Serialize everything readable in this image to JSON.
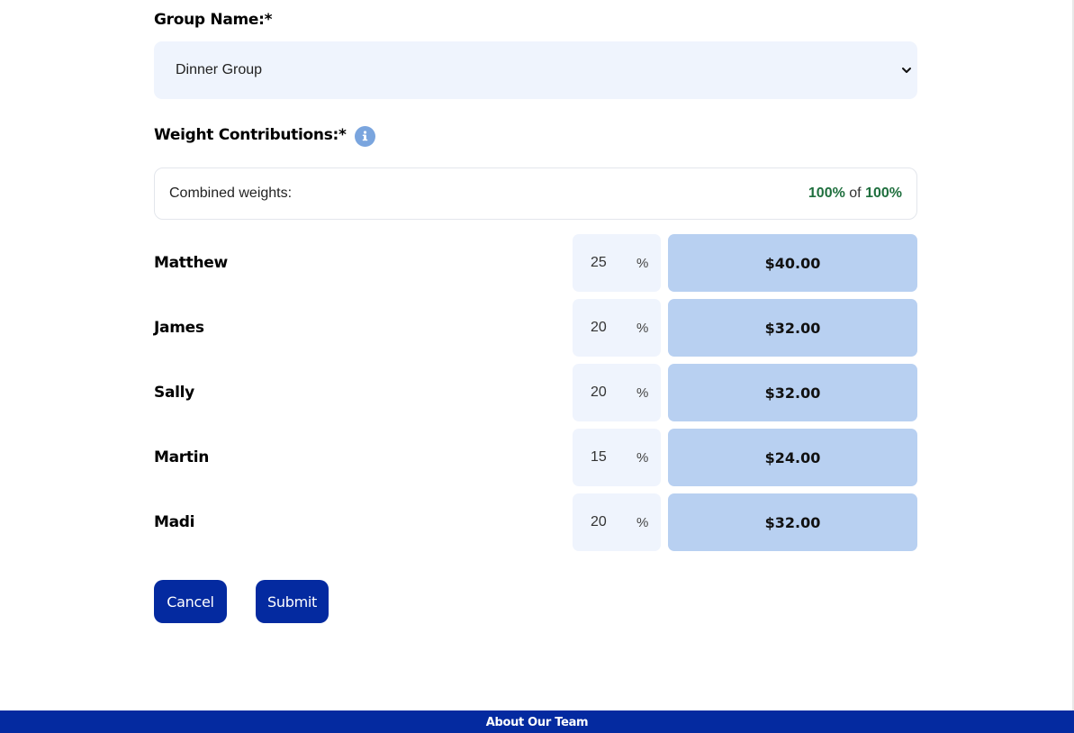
{
  "form": {
    "group_label": "Group Name:*",
    "group_select": {
      "selected": "Dinner Group",
      "icon": "chevron-down-icon"
    },
    "weights_label": "Weight Contributions:*",
    "info_icon": "info-icon",
    "combined": {
      "label": "Combined weights:",
      "current": "100%",
      "of_text": "of",
      "total": "100%"
    },
    "members": [
      {
        "name": "Matthew",
        "weight": "25",
        "unit": "%",
        "amount": "$40.00"
      },
      {
        "name": "James",
        "weight": "20",
        "unit": "%",
        "amount": "$32.00"
      },
      {
        "name": "Sally",
        "weight": "20",
        "unit": "%",
        "amount": "$32.00"
      },
      {
        "name": "Martin",
        "weight": "15",
        "unit": "%",
        "amount": "$24.00"
      },
      {
        "name": "Madi",
        "weight": "20",
        "unit": "%",
        "amount": "$32.00"
      }
    ],
    "buttons": {
      "cancel": "Cancel",
      "submit": "Submit"
    }
  },
  "footer": {
    "text": "About Our Team"
  },
  "colors": {
    "primary": "#042aa0",
    "input_bg": "#eff4fd",
    "amount_bg": "#b8d0f1",
    "success": "#1f6f3e",
    "info": "#7aa5de"
  }
}
